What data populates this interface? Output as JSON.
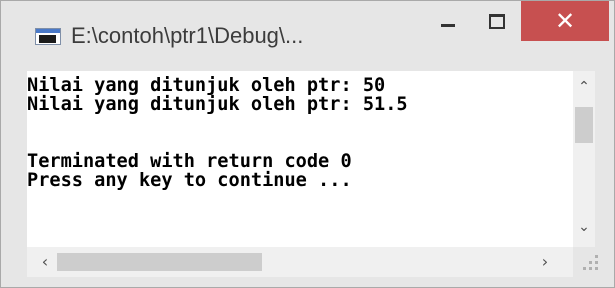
{
  "window": {
    "title": "E:\\contoh\\ptr1\\Debug\\...",
    "close_symbol": "✕",
    "close_color": "#c75050",
    "icons": [
      "console-app-icon",
      "minimize-icon",
      "maximize-icon",
      "close-icon"
    ]
  },
  "console": {
    "lines": [
      "Nilai yang ditunjuk oleh ptr: 50",
      "Nilai yang ditunjuk oleh ptr: 51.5",
      "",
      "",
      "Terminated with return code 0",
      "Press any key to continue ..."
    ]
  },
  "scrollbars": {
    "up_arrow": "⌃",
    "down_arrow": "⌄",
    "left_arrow": "‹",
    "right_arrow": "›"
  }
}
